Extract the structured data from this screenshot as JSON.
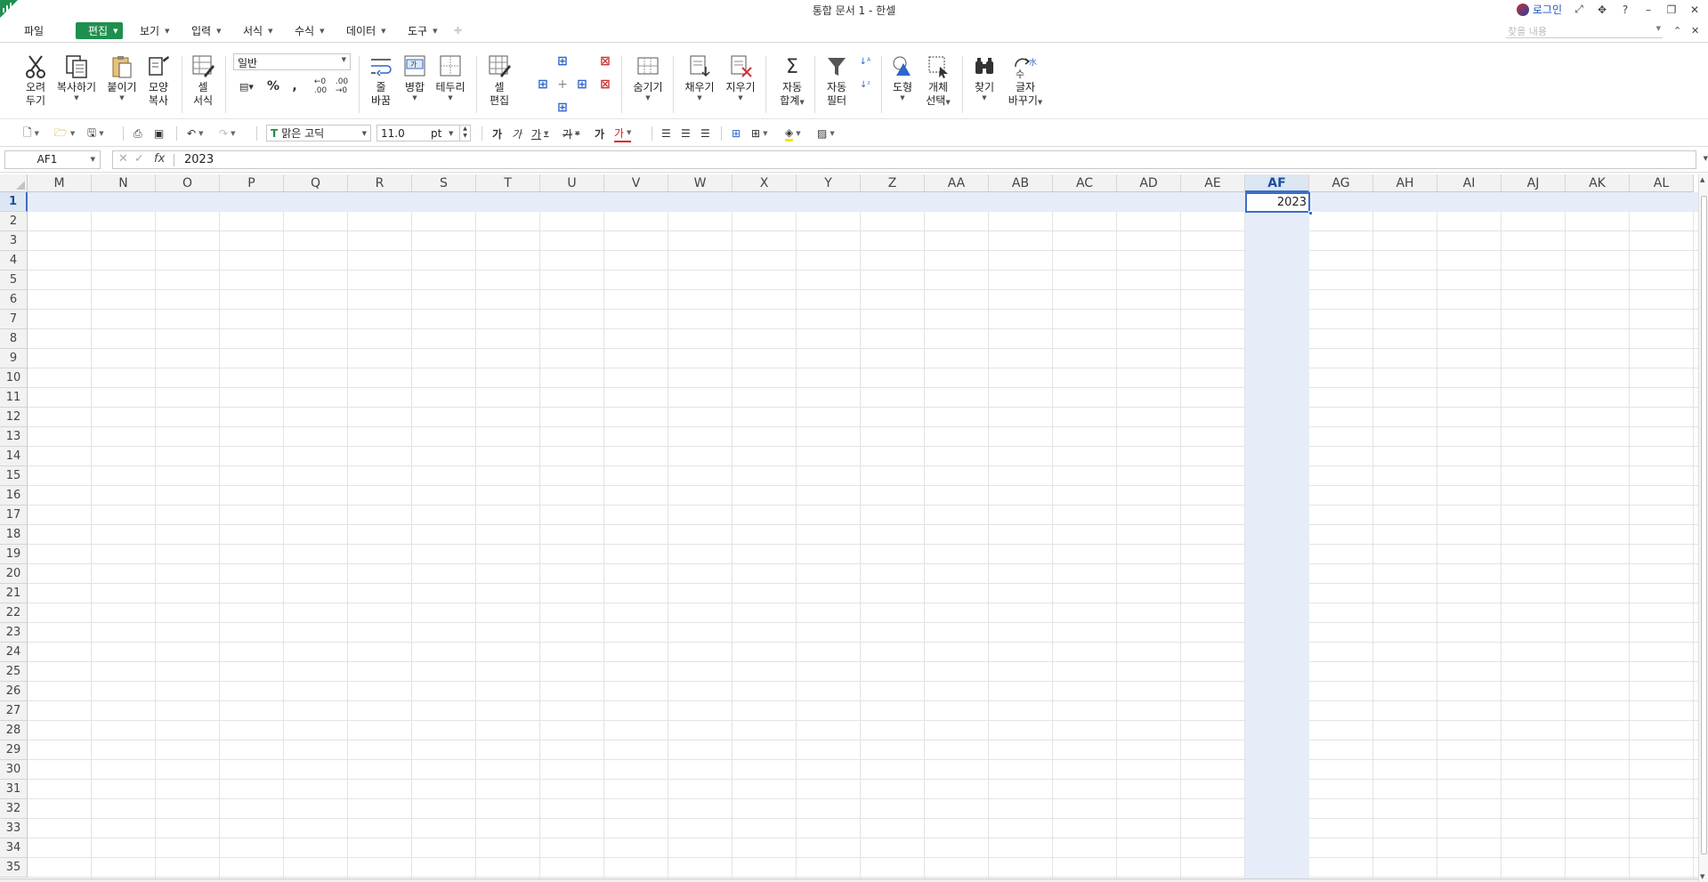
{
  "window": {
    "title": "통합 문서 1 - 한셀",
    "login": "로그인"
  },
  "menu": {
    "items": [
      {
        "label": "파일",
        "active": false
      },
      {
        "label": "편집",
        "active": true
      },
      {
        "label": "보기",
        "active": false
      },
      {
        "label": "입력",
        "active": false
      },
      {
        "label": "서식",
        "active": false
      },
      {
        "label": "수식",
        "active": false
      },
      {
        "label": "데이터",
        "active": false
      },
      {
        "label": "도구",
        "active": false
      }
    ],
    "find_placeholder": "찾을 내용"
  },
  "ribbon": {
    "cut": [
      "오려",
      "두기"
    ],
    "copy": "복사하기",
    "paste": "붙이기",
    "format_painter": [
      "모양",
      "복사"
    ],
    "cell_format": [
      "셀",
      "서식"
    ],
    "number_format": "일반",
    "percent": "%",
    "comma": ",",
    "wrap": [
      "줄",
      "바꿈"
    ],
    "merge": "병합",
    "merge_icon_text": "가",
    "border": "테두리",
    "cell_edit": [
      "셀",
      "편집"
    ],
    "hide": "숨기기",
    "fill": "채우기",
    "clear": "지우기",
    "autosum": [
      "자동",
      "합계"
    ],
    "autofilter": [
      "자동",
      "필터"
    ],
    "shape": "도형",
    "select_object": [
      "개체",
      "선택"
    ],
    "find": "찾기",
    "replace": [
      "글자",
      "바꾸기"
    ],
    "replace_icon_text": "수"
  },
  "format_bar": {
    "font_name": "맑은 고딕",
    "font_size": "11.0",
    "size_unit": "pt",
    "char_glyphs": [
      "가",
      "가",
      "가",
      "가",
      "가",
      "가"
    ]
  },
  "formula_bar": {
    "name_box": "AF1",
    "func_symbol": "fx",
    "value": "2023"
  },
  "sheet": {
    "columns": [
      "M",
      "N",
      "O",
      "P",
      "Q",
      "R",
      "S",
      "T",
      "U",
      "V",
      "W",
      "X",
      "Y",
      "Z",
      "AA",
      "AB",
      "AC",
      "AD",
      "AE",
      "AF",
      "AG",
      "AH",
      "AI",
      "AJ",
      "AK",
      "AL"
    ],
    "selected_column": "AF",
    "rows": [
      1,
      2,
      3,
      4,
      5,
      6,
      7,
      8,
      9,
      10,
      11,
      12,
      13,
      14,
      15,
      16,
      17,
      18,
      19,
      20,
      21,
      22,
      23,
      24,
      25,
      26,
      27,
      28,
      29,
      30,
      31,
      32,
      33,
      34,
      35
    ],
    "selected_row": 1,
    "active_cell_value": "2023"
  },
  "colors": {
    "accent_green": "#1f8f4f",
    "selection_blue": "#3a6fc4",
    "selection_band": "#e6edf8"
  }
}
